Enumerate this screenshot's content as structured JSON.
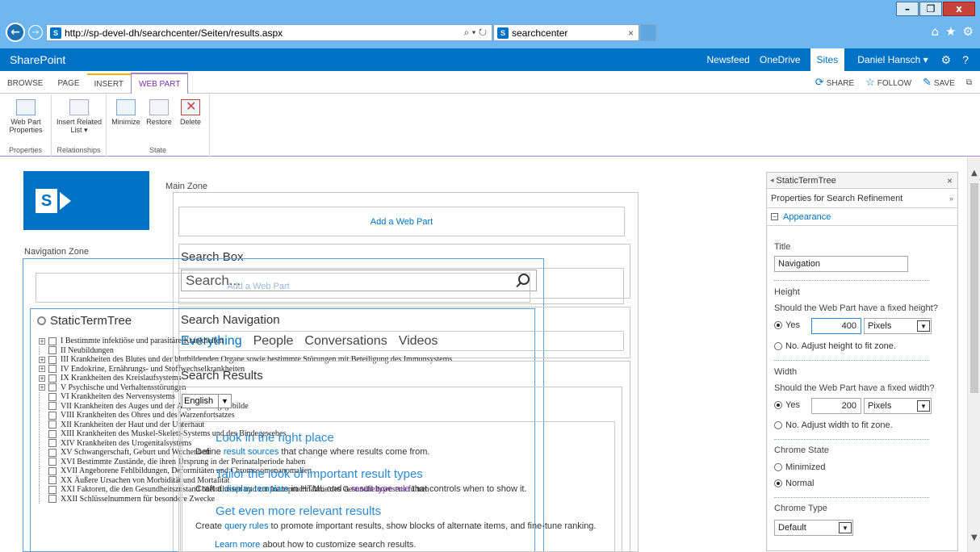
{
  "browser": {
    "url": "http://sp-devel-dh/searchcenter/Seiten/results.aspx",
    "url_host": "sp-devel-dh",
    "tab_title": "searchcenter",
    "favicon": "S",
    "back_glyph": "←",
    "forward_glyph": "→",
    "search_glyph": "⌕ ▾ ↻",
    "tab_close": "×",
    "window_controls": {
      "minimize": "–",
      "restore": "❐",
      "close": "x"
    },
    "icons": {
      "home": "⌂",
      "favorites": "★",
      "settings": "⚙"
    }
  },
  "suitebar": {
    "brand": "SharePoint",
    "links": [
      "Newsfeed",
      "OneDrive",
      "Sites"
    ],
    "user": "Daniel Hansch ▾",
    "settings_glyph": "⚙",
    "help_glyph": "?"
  },
  "ribbon": {
    "tabs": [
      "BROWSE",
      "PAGE",
      "INSERT",
      "WEB PART"
    ],
    "share": "SHARE",
    "follow": "FOLLOW",
    "save": "SAVE",
    "focus_glyph": "⧉",
    "groups": {
      "properties": {
        "label": "Properties",
        "buttons": [
          "Web Part Properties"
        ]
      },
      "relationships": {
        "label": "Relationships",
        "buttons": [
          "Insert Related List ▾"
        ]
      },
      "state": {
        "label": "State",
        "buttons": [
          "Minimize",
          "Restore",
          "Delete"
        ]
      }
    }
  },
  "page": {
    "main_zone": "Main Zone",
    "navigation_zone": "Navigation Zone",
    "add_web_part": "Add a Web Part",
    "search_box": {
      "title": "Search Box",
      "placeholder": "Search..."
    },
    "search_navigation": {
      "title": "Search Navigation",
      "tabs": [
        "Everything",
        "People",
        "Conversations",
        "Videos"
      ]
    },
    "static_term_tree": {
      "title": "StaticTermTree",
      "items": [
        {
          "label": "I Bestimmte infektiöse und parasitäre Krankheiten",
          "expandable": true
        },
        {
          "label": "II Neubildungen",
          "expandable": false
        },
        {
          "label": "III Krankheiten des Blutes und der blutbildenden Organe sowie bestimmte Störungen mit Beteiligung des Immunsystems",
          "expandable": true
        },
        {
          "label": "IV Endokrine, Ernährungs- und Stoffwechselkrankheiten",
          "expandable": true
        },
        {
          "label": "IX Krankheiten des Kreislaufsystems",
          "expandable": true
        },
        {
          "label": "V Psychische und Verhaltensstörungen",
          "expandable": true
        },
        {
          "label": "VI Krankheiten des Nervensystems",
          "expandable": false
        },
        {
          "label": "VII Krankheiten des Auges und der Augenanhangsgebilde",
          "expandable": false
        },
        {
          "label": "VIII Krankheiten des Ohres und des Warzenfortsatzes",
          "expandable": false
        },
        {
          "label": "XII Krankheiten der Haut und der Unterhaut",
          "expandable": false
        },
        {
          "label": "XIII Krankheiten des Muskel-Skelett-Systems und des Bindegewebes",
          "expandable": false
        },
        {
          "label": "XIV Krankheiten des Urogenitalsystems",
          "expandable": false
        },
        {
          "label": "XV Schwangerschaft, Geburt und Wochenbett",
          "expandable": false
        },
        {
          "label": "XVI Bestimmte Zustände, die ihren Ursprung in der Perinatalperiode haben",
          "expandable": false
        },
        {
          "label": "XVII Angeborene Fehlbildungen, Deformitäten und Chromosomenanomalien",
          "expandable": false
        },
        {
          "label": "XX Äußere Ursachen von Morbidität und Mortalität",
          "expandable": false
        },
        {
          "label": "XXI Faktoren, die den Gesundheitszustand beeinflussen und zur Inanspruchnahme des Gesundheitswesens führen",
          "expandable": false
        },
        {
          "label": "XXII Schlüsselnummern für besondere Zwecke",
          "expandable": false
        }
      ]
    },
    "search_results": {
      "title": "Search Results",
      "language": "English",
      "tip1_head": "Look in the right place",
      "tip1_pre": "Define ",
      "tip1_link": "result sources",
      "tip1_post": " that change where results come from.",
      "tip2_head": "Tailor the look of important result types",
      "tip2_pre": "Craft a ",
      "tip2_link1": "display template",
      "tip2_mid": " in HTML and a ",
      "tip2_link2": "result type rule",
      "tip2_post": " that controls when to show it.",
      "tip3_head": "Get even more relevant results",
      "tip3_pre": "Create ",
      "tip3_link": "query rules",
      "tip3_post": " to promote important results, show blocks of alternate items, and fine-tune ranking.",
      "tip4_link": "Learn more",
      "tip4_post": " about how to customize search results."
    }
  },
  "toolpane": {
    "header": "StaticTermTree",
    "header_back": "◂",
    "close": "×",
    "subtitle": "Properties for Search Refinement",
    "subtitle_chevron": "»",
    "section": "Appearance",
    "section_toggle": "−",
    "title_label": "Title",
    "title_value": "Navigation",
    "height_label": "Height",
    "height_question": "Should the Web Part have a fixed height?",
    "yes": "Yes",
    "height_value": "400",
    "unit": "Pixels",
    "height_no": "No. Adjust height to fit zone.",
    "width_label": "Width",
    "width_question": "Should the Web Part have a fixed width?",
    "width_value": "200",
    "width_no": "No. Adjust width to fit zone.",
    "chrome_state_label": "Chrome State",
    "minimized": "Minimized",
    "normal": "Normal",
    "chrome_type_label": "Chrome Type",
    "chrome_type_value": "Default",
    "dropdown_arrow": "▼"
  }
}
